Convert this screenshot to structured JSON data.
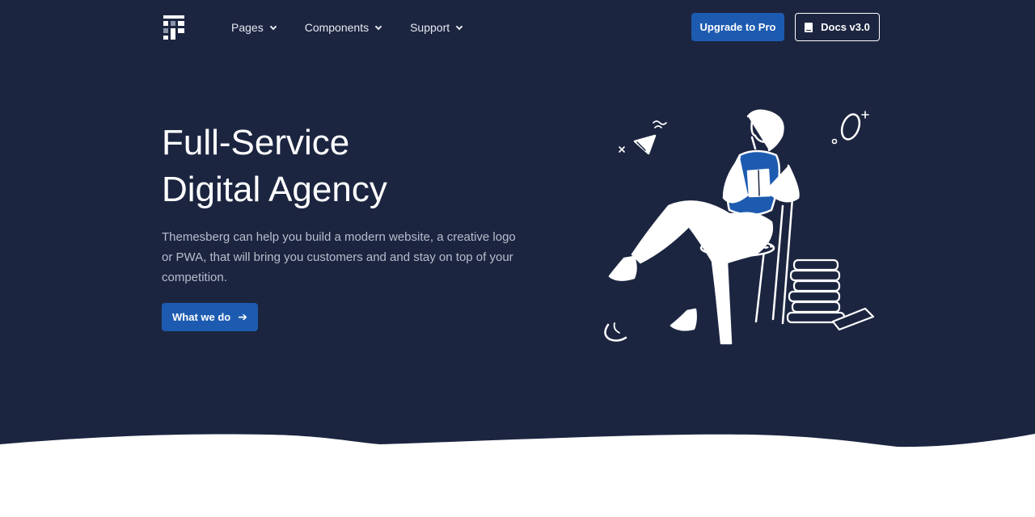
{
  "nav": {
    "items": [
      {
        "label": "Pages"
      },
      {
        "label": "Components"
      },
      {
        "label": "Support"
      }
    ],
    "upgrade_label": "Upgrade to Pro",
    "docs_label": "Docs v3.0"
  },
  "hero": {
    "title_line1": "Full-Service",
    "title_line2": "Digital Agency",
    "subtitle": "Themesberg can help you build a modern website, a creative logo or PWA, that will bring you customers and and stay on top of your competition.",
    "cta_label": "What we do"
  },
  "colors": {
    "background": "#1c2540",
    "accent": "#1d5bb0",
    "text": "#ffffff"
  },
  "icons": [
    "logo-icon",
    "chevron-down-icon",
    "book-icon",
    "arrow-right-icon"
  ]
}
